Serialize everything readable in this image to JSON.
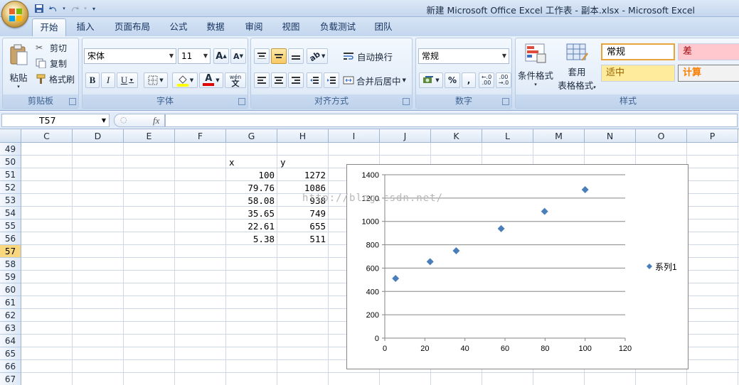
{
  "window": {
    "title": "新建 Microsoft Office Excel 工作表 - 副本.xlsx - Microsoft Excel"
  },
  "tabs": [
    "开始",
    "插入",
    "页面布局",
    "公式",
    "数据",
    "审阅",
    "视图",
    "负载测试",
    "团队"
  ],
  "ribbon": {
    "clipboard": {
      "label": "剪贴板",
      "paste": "粘贴",
      "cut": "剪切",
      "copy": "复制",
      "format_painter": "格式刷"
    },
    "font": {
      "label": "字体",
      "name": "宋体",
      "size": "11",
      "bold": "B",
      "italic": "I",
      "underline": "U",
      "grow": "A",
      "shrink": "A",
      "font_color_glyph": "A",
      "phonetic": "wén"
    },
    "alignment": {
      "label": "对齐方式",
      "wrap_text": "自动换行",
      "merge_center": "合并后居中"
    },
    "number": {
      "label": "数字",
      "format": "常规",
      "percent": "%",
      "comma": ","
    },
    "styles": {
      "label": "样式",
      "conditional": "条件格式",
      "table_format_1": "套用",
      "table_format_2": "表格格式",
      "normal": "常规",
      "bad": "差",
      "neutral": "适中",
      "calculation": "计算"
    }
  },
  "formula_bar": {
    "name_box": "T57",
    "fx": "fx",
    "formula": ""
  },
  "grid": {
    "columns": [
      "C",
      "D",
      "E",
      "F",
      "G",
      "H",
      "I",
      "J",
      "K",
      "L",
      "M",
      "N",
      "O",
      "P"
    ],
    "rows": [
      "49",
      "50",
      "51",
      "52",
      "53",
      "54",
      "55",
      "56",
      "57",
      "58",
      "59",
      "60",
      "61",
      "62",
      "63",
      "64",
      "65",
      "66",
      "67"
    ],
    "selected_row": "57",
    "header_x": "x",
    "header_y": "y",
    "x_values": [
      "100",
      "79.76",
      "58.08",
      "35.65",
      "22.61",
      "5.38"
    ],
    "y_values": [
      "1272",
      "1086",
      "938",
      "749",
      "655",
      "511"
    ]
  },
  "watermark": "http://blog.csdn.net/",
  "chart_data": {
    "type": "scatter",
    "series": [
      {
        "name": "系列1",
        "color": "#4a7ebb",
        "x": [
          100,
          79.76,
          58.08,
          35.65,
          22.61,
          5.38
        ],
        "y": [
          1272,
          1086,
          938,
          749,
          655,
          511
        ]
      }
    ],
    "xlim": [
      0,
      120
    ],
    "ylim": [
      0,
      1400
    ],
    "x_ticks": [
      "0",
      "20",
      "40",
      "60",
      "80",
      "100",
      "120"
    ],
    "y_ticks": [
      "0",
      "200",
      "400",
      "600",
      "800",
      "1000",
      "1200",
      "1400"
    ],
    "grid": "horizontal",
    "legend": "right"
  }
}
